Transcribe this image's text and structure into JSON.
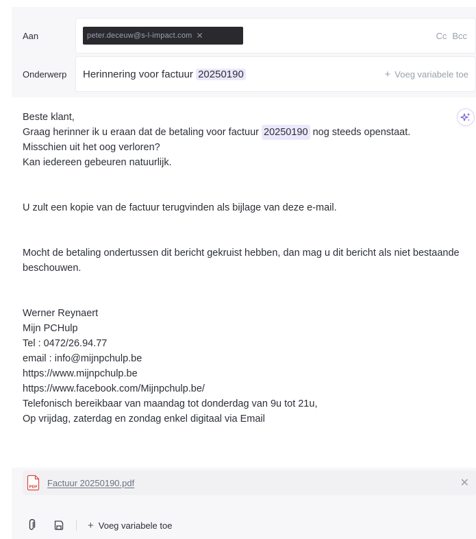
{
  "to": {
    "label": "Aan",
    "recipient": "peter.deceuw@s-l-impact.com",
    "remove_glyph": "✕",
    "cc_label": "Cc",
    "bcc_label": "Bcc"
  },
  "subject": {
    "label": "Onderwerp",
    "text_prefix": "Herinnering voor factuur ",
    "variable": "20250190",
    "add_variable_label": "Voeg variabele toe"
  },
  "body": {
    "greeting": "Beste klant,",
    "line1_prefix": "Graag herinner ik u eraan dat de betaling voor factuur ",
    "line1_variable": "20250190",
    "line1_suffix": " nog steeds openstaat.",
    "line2": "Misschien uit het oog verloren?",
    "line3": "Kan iedereen gebeuren natuurlijk.",
    "paragraph2": "U zult een kopie van de factuur terugvinden als bijlage van deze e-mail.",
    "paragraph3": "Mocht de betaling ondertussen dit bericht gekruist hebben, dan mag u dit bericht als niet bestaande beschouwen.",
    "signature": [
      "Werner Reynaert",
      "Mijn PCHulp",
      "Tel : 0472/26.94.77",
      "email : info@mijnpchulp.be",
      "https://www.mijnpchulp.be",
      "https://www.facebook.com/Mijnpchulp.be/",
      "Telefonisch bereikbaar van maandag tot donderdag van 9u tot 21u,",
      "Op vrijdag, zaterdag en zondag enkel digitaal via Email"
    ]
  },
  "attachment": {
    "filename": "Factuur 20250190.pdf",
    "icon_label": "PDF",
    "close_glyph": "✕"
  },
  "toolbar": {
    "add_variable_label": "Voeg variabele toe"
  },
  "colors": {
    "accent_variable_bg": "#ece8fb",
    "pdf_red": "#d94a3d",
    "ai_purple": "#7c5cd6"
  }
}
